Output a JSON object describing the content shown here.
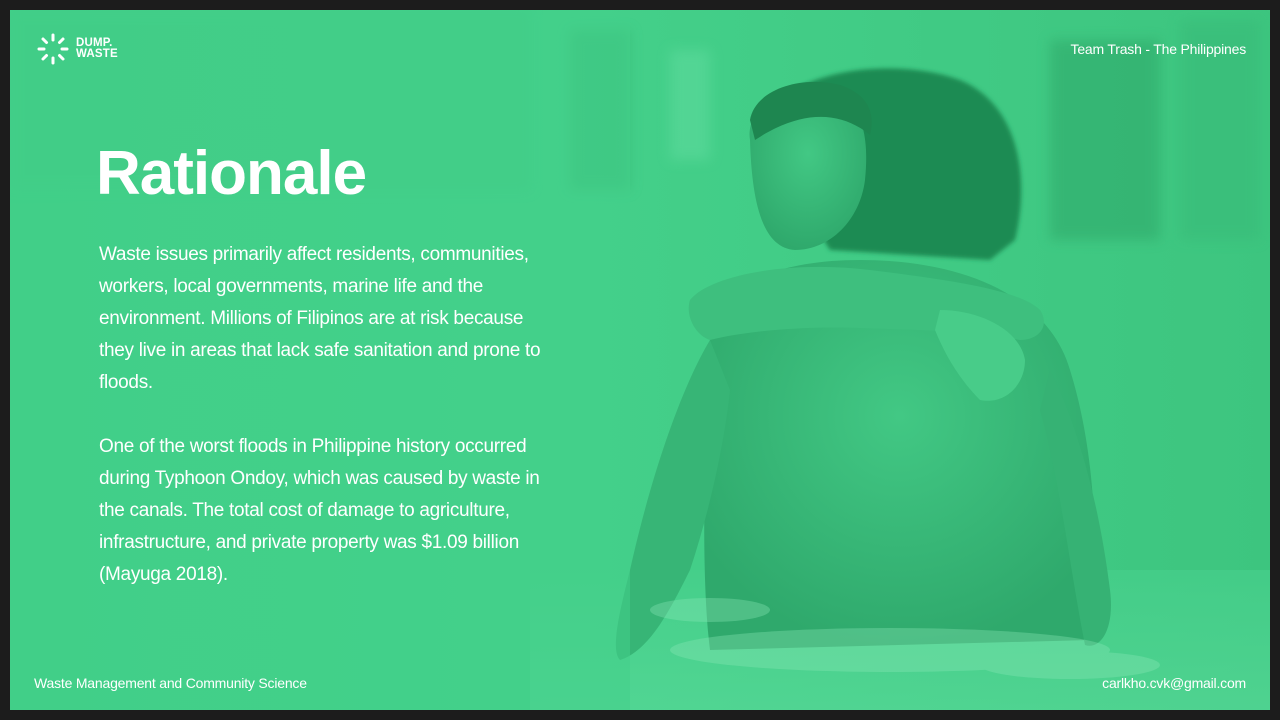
{
  "logo": {
    "line1": "DUMP.",
    "line2": "WASTE",
    "icon": "sunburst-icon"
  },
  "header": {
    "right_text": "Team Trash - The Philippines"
  },
  "slide": {
    "title": "Rationale",
    "paragraphs": [
      "Waste issues primarily affect residents, communities, workers, local governments, marine life and the environment.  Millions of Filipinos are at risk because they live in areas that lack safe sanitation and prone to floods.",
      "One of the worst floods in Philippine history occurred during Typhoon Ondoy, which was caused by waste in the canals. The total cost of damage to agriculture, infrastructure, and private property was $1.09 billion (Mayuga 2018)."
    ]
  },
  "footer": {
    "left_text": "Waste Management and Community Science",
    "right_text": "carlkho.cvk@gmail.com"
  },
  "colors": {
    "accent_green": "#44d08a",
    "frame": "#1c1c1c",
    "text": "#ffffff"
  }
}
